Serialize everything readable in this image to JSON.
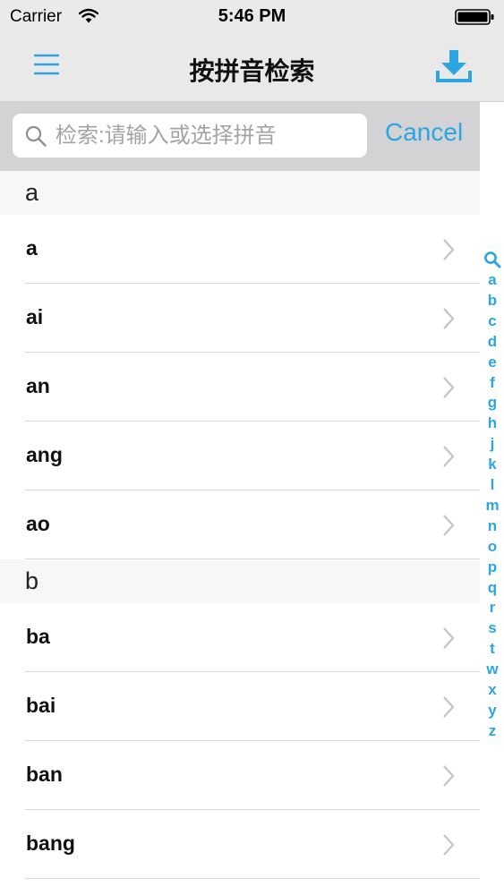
{
  "status_bar": {
    "carrier": "Carrier",
    "time": "5:46 PM"
  },
  "nav": {
    "title": "按拼音检索",
    "menu_icon": "hamburger-menu-icon",
    "download_icon": "download-icon"
  },
  "search": {
    "placeholder": "检索:请输入或选择拼音",
    "value": "",
    "cancel_label": "Cancel"
  },
  "sections": [
    {
      "header": "a",
      "rows": [
        "a",
        "ai",
        "an",
        "ang",
        "ao"
      ]
    },
    {
      "header": "b",
      "rows": [
        "ba",
        "bai",
        "ban",
        "bang"
      ]
    }
  ],
  "index_letters": [
    "a",
    "b",
    "c",
    "d",
    "e",
    "f",
    "g",
    "h",
    "j",
    "k",
    "l",
    "m",
    "n",
    "o",
    "p",
    "q",
    "r",
    "s",
    "t",
    "w",
    "x",
    "y",
    "z"
  ],
  "colors": {
    "accent": "#2ba6e0",
    "nav_bg": "#e9e9e9",
    "search_area_bg": "#d3d3d5",
    "section_bg": "#f7f7f7"
  }
}
